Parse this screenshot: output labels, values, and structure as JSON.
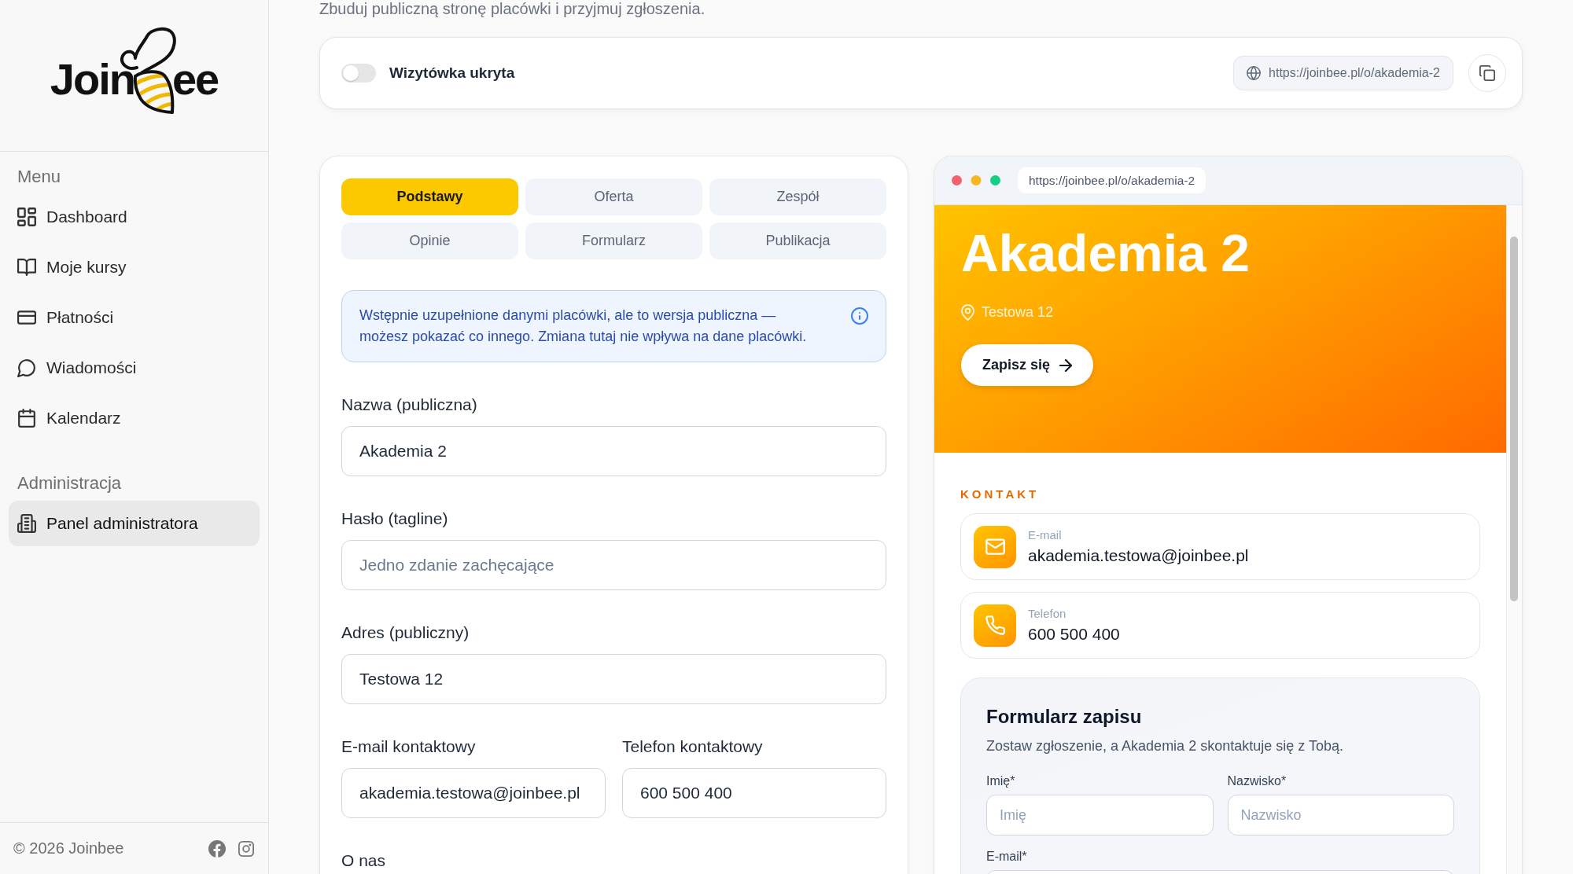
{
  "sidebar": {
    "logo": {
      "text_start": "Join",
      "text_end": "ee"
    },
    "sections": [
      {
        "heading": "Menu",
        "items": [
          {
            "label": "Dashboard",
            "selected": false
          },
          {
            "label": "Moje kursy",
            "selected": false
          },
          {
            "label": "Płatności",
            "selected": false
          },
          {
            "label": "Wiadomości",
            "selected": false
          },
          {
            "label": "Kalendarz",
            "selected": false
          }
        ]
      },
      {
        "heading": "Administracja",
        "items": [
          {
            "label": "Panel administratora",
            "selected": true
          }
        ]
      }
    ],
    "footer": {
      "copyright": "© 2026 Joinbee"
    }
  },
  "page": {
    "subtitle": "Zbuduj publiczną stronę placówki i przyjmuj zgłoszenia."
  },
  "publish_bar": {
    "toggle": {
      "label": "Wizytówka ukryta",
      "on": false
    },
    "url": "https://joinbee.pl/o/akademia-2"
  },
  "editor": {
    "tabs": [
      {
        "label": "Podstawy",
        "selected": true
      },
      {
        "label": "Oferta",
        "selected": false
      },
      {
        "label": "Zespół",
        "selected": false
      },
      {
        "label": "Opinie",
        "selected": false
      },
      {
        "label": "Formularz",
        "selected": false
      },
      {
        "label": "Publikacja",
        "selected": false
      }
    ],
    "notice": "Wstępnie uzupełnione danymi placówki, ale to wersja publiczna — możesz pokazać co innego. Zmiana tutaj nie wpływa na dane placówki.",
    "fields": [
      {
        "label": "Nazwa (publiczna)",
        "value": "Akademia 2"
      },
      {
        "label": "Hasło (tagline)",
        "placeholder": "Jedno zdanie zachęcające"
      },
      {
        "label": "Adres (publiczny)",
        "value": "Testowa 12"
      }
    ],
    "contact_fields": [
      {
        "label": "E-mail kontaktowy",
        "value": "akademia.testowa@joinbee.pl"
      },
      {
        "label": "Telefon kontaktowy",
        "value": "600 500 400"
      }
    ],
    "next_label": "O nas"
  },
  "preview": {
    "url": "https://joinbee.pl/o/akademia-2",
    "hero": {
      "title": "Akademia 2",
      "address": "Testowa 12",
      "button": "Zapisz się"
    },
    "contact_heading": "KONTAKT",
    "contacts": [
      {
        "label": "E-mail",
        "value": "akademia.testowa@joinbee.pl"
      },
      {
        "label": "Telefon",
        "value": "600 500 400"
      }
    ],
    "signup_form": {
      "title": "Formularz zapisu",
      "subtitle": "Zostaw zgłoszenie, a Akademia 2 skontaktuje się z Tobą.",
      "fields": [
        {
          "label": "Imię*",
          "placeholder": "Imię"
        },
        {
          "label": "Nazwisko*",
          "placeholder": "Nazwisko"
        },
        {
          "label": "E-mail*"
        }
      ]
    }
  }
}
